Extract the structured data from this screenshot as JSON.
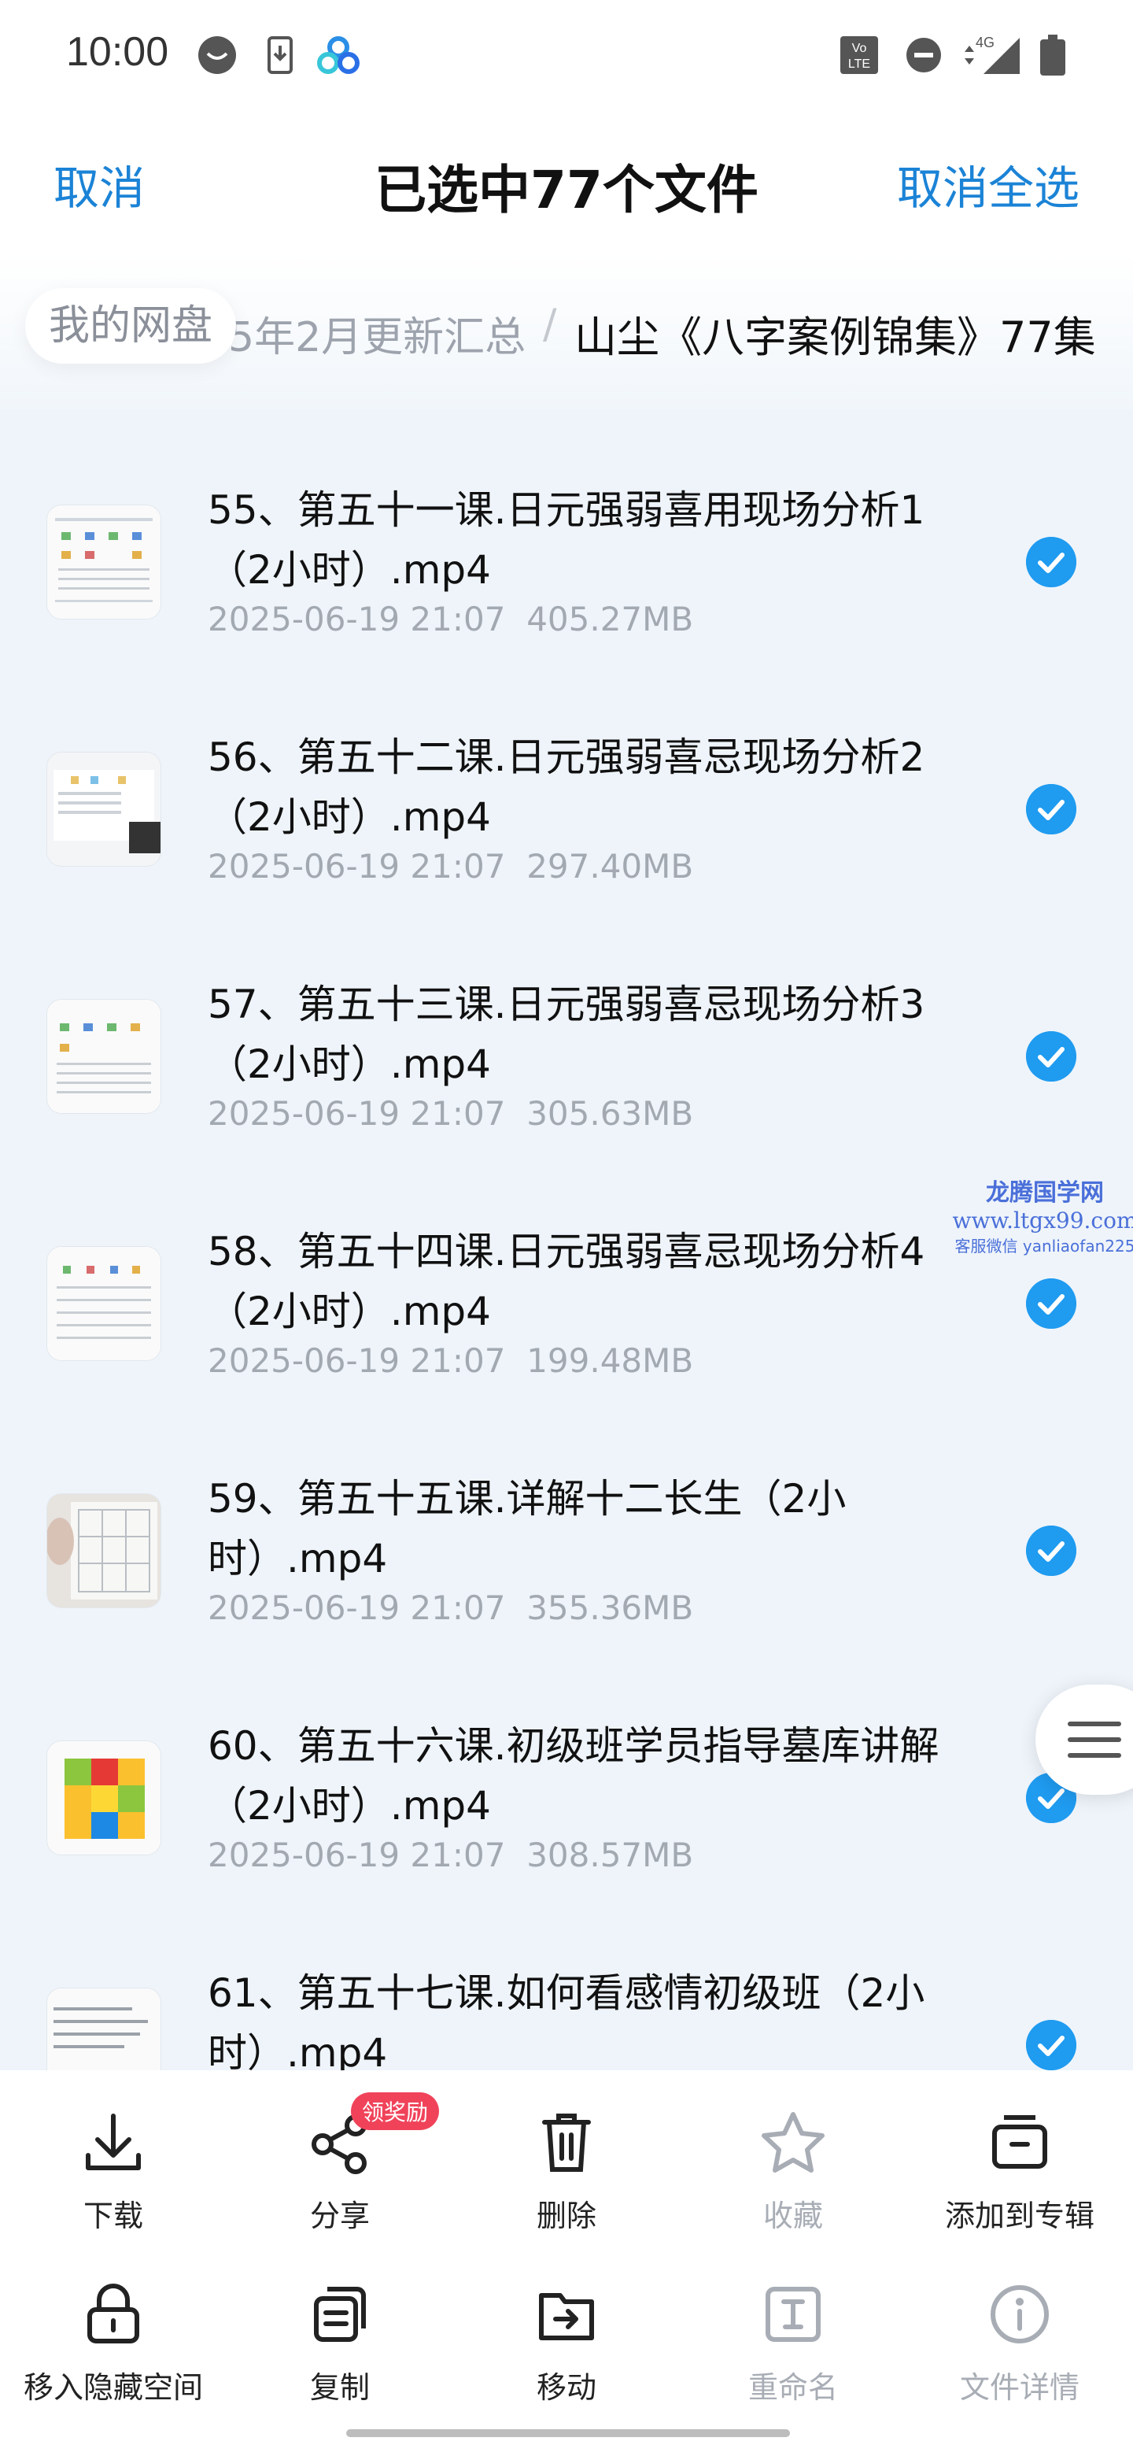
{
  "status_bar": {
    "time": "10:00",
    "network": "4G",
    "volte": "Vo LTE"
  },
  "header": {
    "cancel": "取消",
    "title": "已选中77个文件",
    "deselect_all": "取消全选"
  },
  "breadcrumb": {
    "home": "我的网盘",
    "middle": "5年2月更新汇总",
    "separator": "/",
    "current": "山尘《八字案例锦集》77集"
  },
  "files": [
    {
      "name": "55、第五十一课.日元强弱喜用现场分析1（2小时）.mp4",
      "date": "2025-06-19  21:07",
      "size": "405.27MB",
      "selected": true
    },
    {
      "name": "56、第五十二课.日元强弱喜忌现场分析2（2小时）.mp4",
      "date": "2025-06-19  21:07",
      "size": "297.40MB",
      "selected": true
    },
    {
      "name": "57、第五十三课.日元强弱喜忌现场分析3（2小时）.mp4",
      "date": "2025-06-19  21:07",
      "size": "305.63MB",
      "selected": true
    },
    {
      "name": "58、第五十四课.日元强弱喜忌现场分析4（2小时）.mp4",
      "date": "2025-06-19  21:07",
      "size": "199.48MB",
      "selected": true
    },
    {
      "name": "59、第五十五课.详解十二长生（2小时）.mp4",
      "date": "2025-06-19  21:07",
      "size": "355.36MB",
      "selected": true
    },
    {
      "name": "60、第五十六课.初级班学员指导墓库讲解（2小时）.mp4",
      "date": "2025-06-19  21:07",
      "size": "308.57MB",
      "selected": true
    },
    {
      "name": "61、第五十七课.如何看感情初级班（2小时）.mp4",
      "date": "",
      "size": "",
      "selected": true
    }
  ],
  "watermark": {
    "line1": "龙腾国学网",
    "line2": "www.ltgx99.com",
    "line3": "客服微信 yanliaofan225"
  },
  "actions": {
    "download": "下载",
    "share": "分享",
    "share_badge": "领奖励",
    "delete": "删除",
    "favorite": "收藏",
    "add_to_album": "添加到专辑",
    "move_to_hidden": "移入隐藏空间",
    "copy": "复制",
    "move": "移动",
    "rename": "重命名",
    "file_details": "文件详情"
  },
  "colors": {
    "accent": "#1b83d6",
    "check": "#1f9bf0",
    "list_bg": "#eef4fa",
    "badge": "#f0435a"
  }
}
